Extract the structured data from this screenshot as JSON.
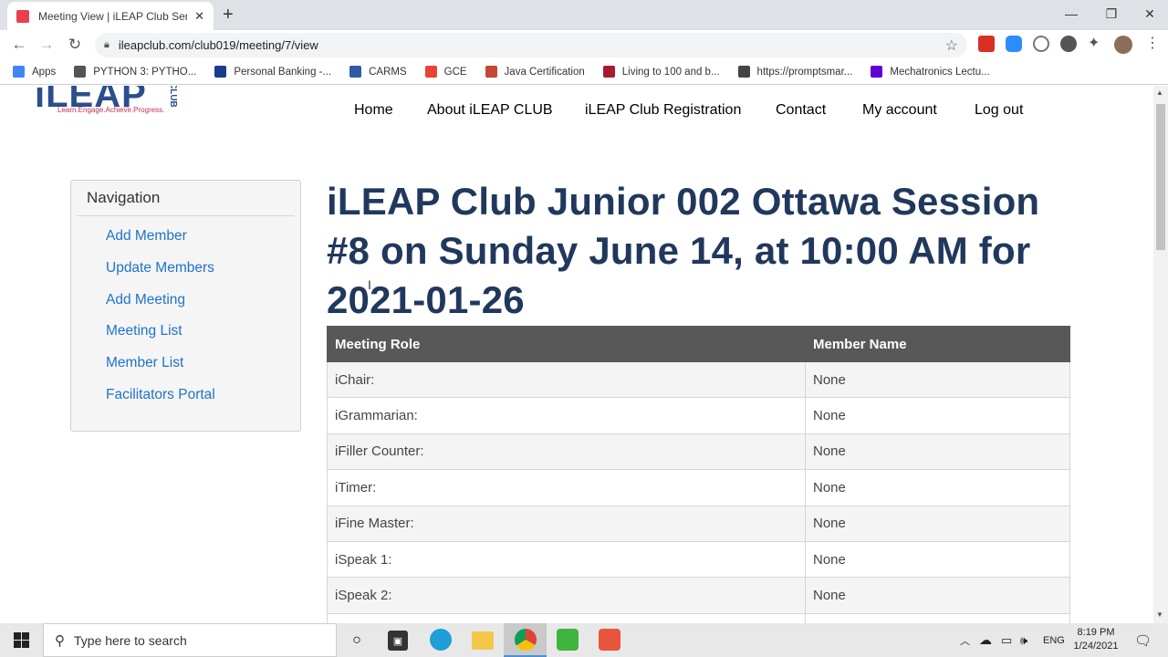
{
  "browser": {
    "tab_title": "Meeting View | iLEAP Club Senio",
    "url": "ileapclub.com/club019/meeting/7/view",
    "bookmarks": [
      {
        "label": "Apps",
        "icon": "apps-grid-icon",
        "color": "#4285f4"
      },
      {
        "label": "PYTHON 3: PYTHO...",
        "icon": "python-icon",
        "color": "#555555"
      },
      {
        "label": "Personal Banking -...",
        "icon": "bank-icon",
        "color": "#1a3c8f"
      },
      {
        "label": "CARMS",
        "icon": "carms-icon",
        "color": "#2f5aa8"
      },
      {
        "label": "GCE",
        "icon": "google-icon",
        "color": "#ea4335"
      },
      {
        "label": "Java Certification",
        "icon": "oracle-icon",
        "color": "#c74634"
      },
      {
        "label": "Living to 100 and b...",
        "icon": "harvard-icon",
        "color": "#a51c30"
      },
      {
        "label": "https://promptsmar...",
        "icon": "globe-icon",
        "color": "#444444"
      },
      {
        "label": "Mechatronics Lectu...",
        "icon": "yahoo-icon",
        "color": "#6001d2"
      }
    ]
  },
  "site": {
    "logo_text": "iLEAP",
    "logo_tagline": "Learn.Engage.Achieve.Progress.",
    "logo_club": "CLUB",
    "nav": [
      "Home",
      "About iLEAP CLUB",
      "iLEAP Club Registration",
      "Contact",
      "My account",
      "Log out"
    ]
  },
  "sidebar": {
    "heading": "Navigation",
    "links": [
      "Add Member",
      "Update Members",
      "Add Meeting",
      "Meeting List",
      "Member List",
      "Facilitators Portal"
    ]
  },
  "main": {
    "title": "iLEAP Club Junior 002 Ottawa Session #8 on Sunday June 14, at 10:00 AM for 2021-01-26",
    "table": {
      "headers": [
        "Meeting Role",
        "Member Name"
      ],
      "rows": [
        [
          "iChair:",
          "None"
        ],
        [
          "iGrammarian:",
          "None"
        ],
        [
          "iFiller Counter:",
          "None"
        ],
        [
          "iTimer:",
          "None"
        ],
        [
          "iFine Master:",
          "None"
        ],
        [
          "iSpeak 1:",
          "None"
        ],
        [
          "iSpeak 2:",
          "None"
        ],
        [
          "",
          ""
        ]
      ]
    }
  },
  "taskbar": {
    "search_placeholder": "Type here to search",
    "language": "ENG",
    "time": "8:19 PM",
    "date": "1/24/2021"
  },
  "colors": {
    "title": "#21385d",
    "link": "#1f73c9",
    "table_header": "#585858"
  }
}
